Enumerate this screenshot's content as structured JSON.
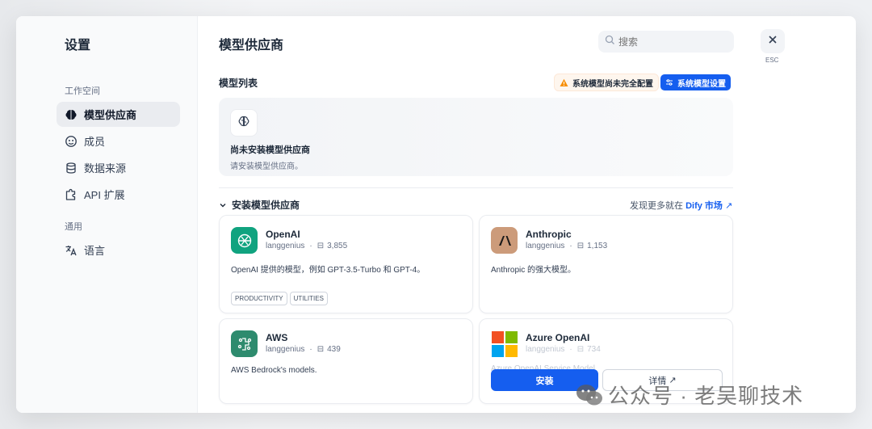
{
  "sidebar": {
    "title": "设置",
    "workspace_label": "工作空间",
    "items": [
      {
        "label": "模型供应商",
        "icon": "brain-icon"
      },
      {
        "label": "成员",
        "icon": "members-icon"
      },
      {
        "label": "数据来源",
        "icon": "database-icon"
      },
      {
        "label": "API 扩展",
        "icon": "puzzle-icon"
      }
    ],
    "general_label": "通用",
    "general_items": [
      {
        "label": "语言",
        "icon": "translate-icon"
      }
    ]
  },
  "main": {
    "title": "模型供应商",
    "search_placeholder": "搜索",
    "esc_label": "ESC",
    "model_list_label": "模型列表",
    "warning_text": "系统模型尚未完全配置",
    "system_settings_label": "系统模型设置",
    "empty_title": "尚未安装模型供应商",
    "empty_desc": "请安装模型供应商。",
    "install_section_label": "安装模型供应商",
    "market_text": "发现更多就在",
    "market_link": "Dify 市场",
    "providers": [
      {
        "name": "OpenAI",
        "author": "langgenius",
        "installs": "3,855",
        "description": "OpenAI 提供的模型，例如 GPT-3.5-Turbo 和 GPT-4。",
        "tags": [
          "PRODUCTIVITY",
          "UTILITIES"
        ],
        "color": "#10a37f"
      },
      {
        "name": "Anthropic",
        "author": "langgenius",
        "installs": "1,153",
        "description": "Anthropic 的强大模型。",
        "color": "#cc9b7a"
      },
      {
        "name": "AWS",
        "author": "langgenius",
        "installs": "439",
        "description": "AWS Bedrock's models.",
        "color": "#2e8b6e"
      },
      {
        "name": "Azure OpenAI",
        "author": "langgenius",
        "installs": "734",
        "description": "Azure OpenAI Service Model",
        "install_label": "安装",
        "detail_label": "详情"
      }
    ]
  },
  "watermark": "公众号 · 老吴聊技术"
}
